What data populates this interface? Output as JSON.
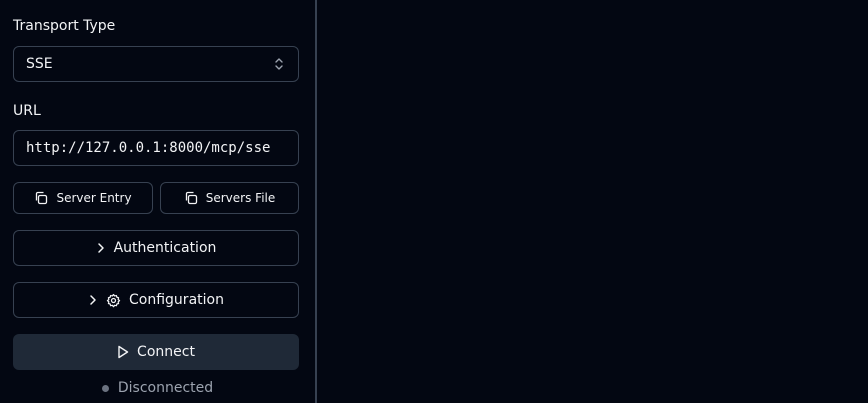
{
  "sidebar": {
    "transport_label": "Transport Type",
    "transport_value": "SSE",
    "url_label": "URL",
    "url_value": "http://127.0.0.1:8000/mcp/sse",
    "server_entry_label": "Server Entry",
    "servers_file_label": "Servers File",
    "authentication_label": "Authentication",
    "configuration_label": "Configuration",
    "connect_label": "Connect",
    "status_text": "Disconnected"
  },
  "icons": {
    "transport_select": "chevrons-up-down-icon",
    "server_entry": "copy-icon",
    "servers_file": "copy-icon",
    "authentication": "chevron-right-icon",
    "configuration_chevron": "chevron-right-icon",
    "configuration": "gear-icon",
    "connect": "play-icon",
    "status": "status-dot-icon"
  },
  "colors": {
    "background": "#030712",
    "border": "#374151",
    "connect_button": "#1f2937",
    "text": "#f3f4f6",
    "muted_text": "#9ca3af",
    "status_dot": "#6b7280"
  }
}
